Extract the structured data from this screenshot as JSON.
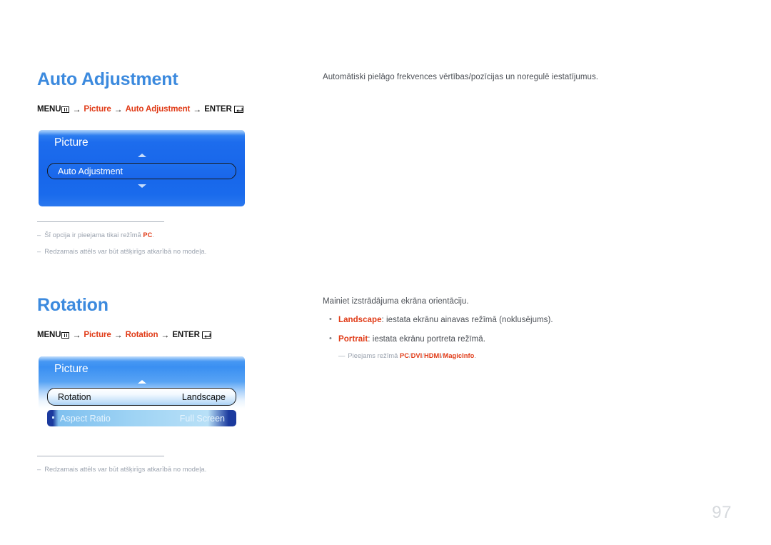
{
  "page": {
    "number": "97",
    "language_note": "lv"
  },
  "sections": [
    {
      "id": "auto-adjustment",
      "title": "Auto Adjustment",
      "breadcrumb": {
        "menu_label": "MENU",
        "menu_icon": "menu-grid-icon",
        "arrow": "→",
        "parts": [
          "Picture",
          "Auto Adjustment"
        ],
        "enter_label": "ENTER",
        "enter_icon": "enter-return-icon"
      },
      "osd": {
        "title": "Picture",
        "arrow_up_icon": "triangle-up-icon",
        "arrow_down_icon": "triangle-down-icon",
        "rows": [
          {
            "label": "Auto Adjustment",
            "value": ""
          }
        ]
      },
      "description": "Automātiski pielāgo frekvences vērtības/pozīcijas un noregulē iestatījumus.",
      "bullets": [],
      "footnotes": [
        {
          "prefix": "–",
          "text_before": "Šī opcija ir pieejama tikai režīmā ",
          "highlight": "PC",
          "text_after": "."
        },
        {
          "prefix": "–",
          "text_before": "Redzamais attēls var būt atšķirīgs atkarībā no modeļa.",
          "highlight": "",
          "text_after": ""
        }
      ]
    },
    {
      "id": "rotation",
      "title": "Rotation",
      "breadcrumb": {
        "menu_label": "MENU",
        "menu_icon": "menu-grid-icon",
        "arrow": "→",
        "parts": [
          "Picture",
          "Rotation"
        ],
        "enter_label": "ENTER",
        "enter_icon": "enter-return-icon"
      },
      "osd": {
        "title": "Picture",
        "arrow_up_icon": "triangle-up-icon",
        "rows": [
          {
            "label": "Rotation",
            "value": "Landscape"
          },
          {
            "label": "Aspect Ratio",
            "value": "Full Screen"
          }
        ]
      },
      "description": "Mainiet izstrādājuma ekrāna orientāciju.",
      "bullets": [
        {
          "term": "Landscape",
          "text": ": iestata ekrānu ainavas režīmā (noklusējums)."
        },
        {
          "term": "Portrait",
          "text": ": iestata ekrānu portreta režīmā."
        }
      ],
      "subnote": {
        "prefix": "—",
        "text_before": "Pieejams režīmā ",
        "modes": [
          "PC",
          "DVI",
          "HDMI",
          "MagicInfo"
        ],
        "separator": "/",
        "text_after": "."
      },
      "footnotes": [
        {
          "prefix": "–",
          "text_before": "Redzamais attēls var būt atšķirīgs atkarībā no modeļa.",
          "highlight": "",
          "text_after": ""
        }
      ]
    }
  ],
  "colors": {
    "heading_blue": "#3c8ade",
    "accent_red": "#e03a16",
    "osd_blue": "#1766ea",
    "body_gray": "#4b4f55",
    "footnote_gray": "#9aa2ae",
    "page_number_gray": "#d6d9dd"
  }
}
